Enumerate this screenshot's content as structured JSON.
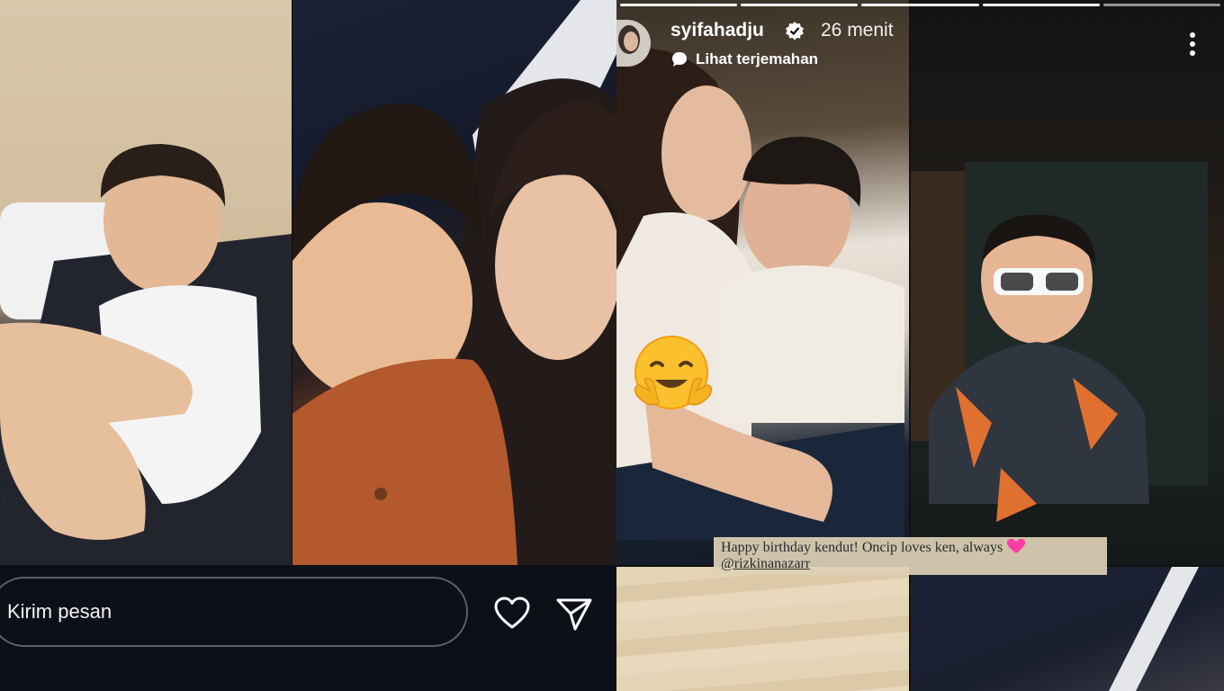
{
  "left_story": {
    "message_placeholder": "Kirim pesan",
    "icons": [
      "heart-icon",
      "send-icon"
    ]
  },
  "right_story": {
    "username": "syifahadju",
    "verified": true,
    "time_ago": "26 menit",
    "translate_label": "Lihat terjemahan",
    "caption_text": "Happy birthday kendut! Oncip loves ken, always",
    "caption_mention": "@rizkinanazarr",
    "caption_emoji": "pink-heart",
    "sticker": "hugging-face-emoji",
    "progress_segments": 5
  },
  "colors": {
    "background": "#0d1018",
    "input_border": "#5c6068",
    "caption_bg": "#ded0b6",
    "heart": "#ff3da5"
  }
}
